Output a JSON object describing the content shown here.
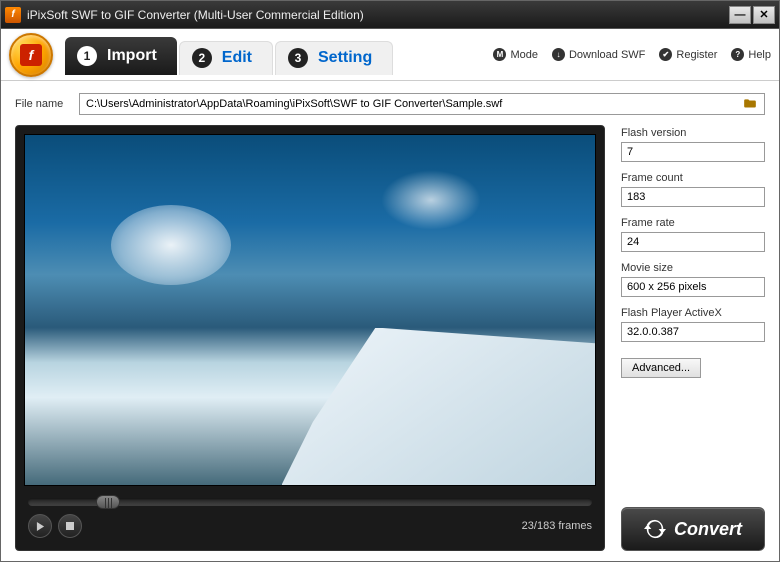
{
  "window": {
    "title": "iPixSoft SWF to GIF Converter (Multi-User Commercial Edition)"
  },
  "tabs": {
    "import": {
      "num": "1",
      "label": "Import"
    },
    "edit": {
      "num": "2",
      "label": "Edit"
    },
    "setting": {
      "num": "3",
      "label": "Setting"
    }
  },
  "toolbar": {
    "mode": "Mode",
    "download": "Download SWF",
    "register": "Register",
    "help": "Help"
  },
  "file": {
    "label": "File name",
    "path": "C:\\Users\\Administrator\\AppData\\Roaming\\iPixSoft\\SWF to GIF Converter\\Sample.swf"
  },
  "player": {
    "frames": "23/183 frames"
  },
  "info": {
    "flash_version_label": "Flash version",
    "flash_version": "7",
    "frame_count_label": "Frame count",
    "frame_count": "183",
    "frame_rate_label": "Frame rate",
    "frame_rate": "24",
    "movie_size_label": "Movie size",
    "movie_size": "600 x 256 pixels",
    "activex_label": "Flash Player ActiveX",
    "activex": "32.0.0.387",
    "advanced": "Advanced..."
  },
  "convert": {
    "label": "Convert"
  }
}
